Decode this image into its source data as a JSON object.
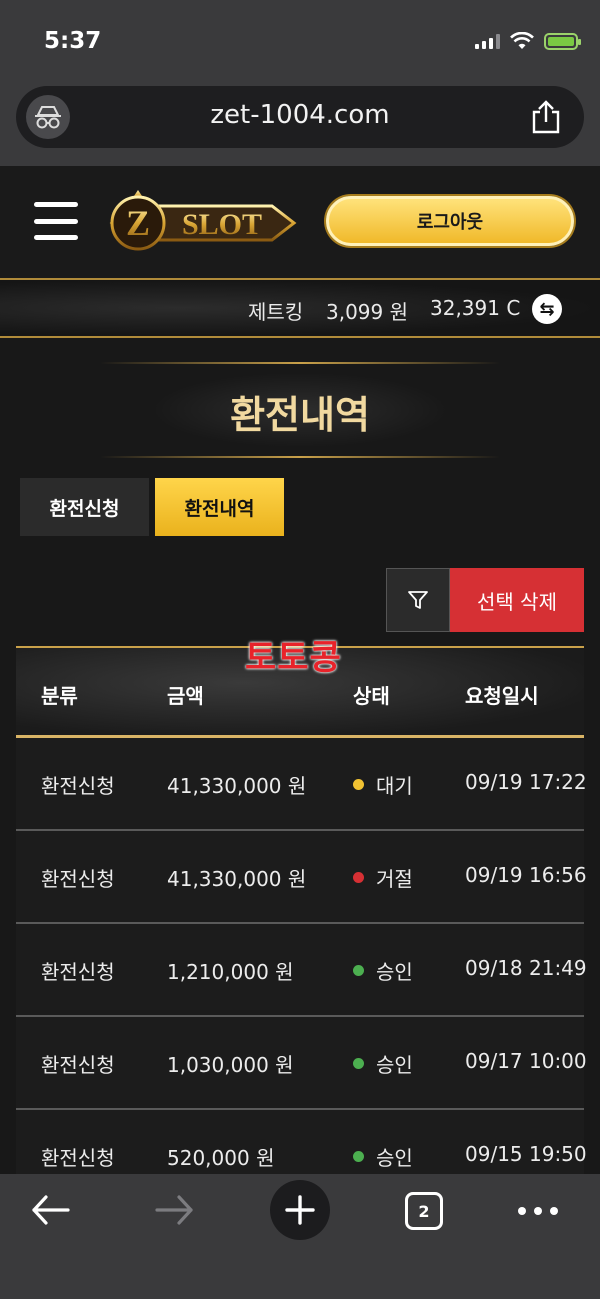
{
  "status_bar": {
    "time": "5:37"
  },
  "browser": {
    "url": "zet-1004.com",
    "tab_count": "2"
  },
  "header": {
    "logo_text": "ZSLOT",
    "logout_label": "로그아웃"
  },
  "balance": {
    "username": "제트킹",
    "won": "3,099 원",
    "coin": "32,391 C",
    "swap_symbol": "⇆"
  },
  "page_title": "환전내역",
  "tabs": [
    {
      "label": "환전신청",
      "active": false
    },
    {
      "label": "환전내역",
      "active": true
    }
  ],
  "actions": {
    "delete_label": "선택 삭제"
  },
  "watermark": "토토콩",
  "table": {
    "columns": [
      "분류",
      "금액",
      "상태",
      "요청일시"
    ],
    "rows": [
      {
        "type": "환전신청",
        "amount": "41,330,000 원",
        "status": "대기",
        "status_color": "#f1c232",
        "datetime": "09/19 17:22"
      },
      {
        "type": "환전신청",
        "amount": "41,330,000 원",
        "status": "거절",
        "status_color": "#d63034",
        "datetime": "09/19 16:56"
      },
      {
        "type": "환전신청",
        "amount": "1,210,000 원",
        "status": "승인",
        "status_color": "#4caf50",
        "datetime": "09/18 21:49"
      },
      {
        "type": "환전신청",
        "amount": "1,030,000 원",
        "status": "승인",
        "status_color": "#4caf50",
        "datetime": "09/17 10:00"
      },
      {
        "type": "환전신청",
        "amount": "520,000 원",
        "status": "승인",
        "status_color": "#4caf50",
        "datetime": "09/15 19:50"
      }
    ]
  },
  "colors": {
    "accent_gold": "#f0b92a",
    "danger": "#d63034",
    "background": "#181818"
  }
}
